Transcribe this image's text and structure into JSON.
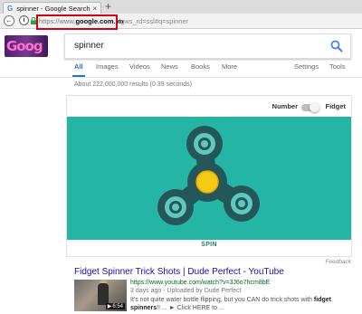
{
  "browser": {
    "tab_favicon": "G",
    "tab_title": "spinner - Google Search",
    "tab_close": "×",
    "new_tab": "+",
    "back_glyph": "←",
    "info_glyph": "i",
    "url_prefix": "https://www.",
    "url_domain": "google.com.vn",
    "url_rest": "/gws_rd=ssl#q=spinner"
  },
  "header": {
    "doodle_text": "Goog",
    "search_query": "spinner"
  },
  "tabs": {
    "all": "All",
    "images": "Images",
    "videos": "Videos",
    "news": "News",
    "books": "Books",
    "more": "More",
    "settings": "Settings",
    "tools": "Tools"
  },
  "stats": "About 222,000,000 results (0.39 seconds)",
  "spinner_card": {
    "toggle_left": "Number",
    "toggle_right": "Fidget",
    "spin_label": "SPIN"
  },
  "feedback": "Feedback",
  "result": {
    "title": "Fidget Spinner Trick Shots | Dude Perfect - YouTube",
    "duration": "6:54",
    "url": "https://www.youtube.com/watch?v=3J6o7hcm8bE",
    "meta": "3 days ago - Uploaded by Dude Perfect",
    "snippet_start": "It's not quite water bottle flipping, but you CAN do trick shots with ",
    "snippet_bold": "fidget spinners",
    "snippet_end": "!! ... ► Click HERE to ..."
  },
  "colors": {
    "spinner_bg": "#25b5a5",
    "spinner_body": "#24565a",
    "spinner_bearing": "#5fc9bf",
    "spinner_center": "#f6c915",
    "link_blue": "#1a0dab",
    "url_green": "#006621",
    "highlight_red": "#d0021b"
  }
}
